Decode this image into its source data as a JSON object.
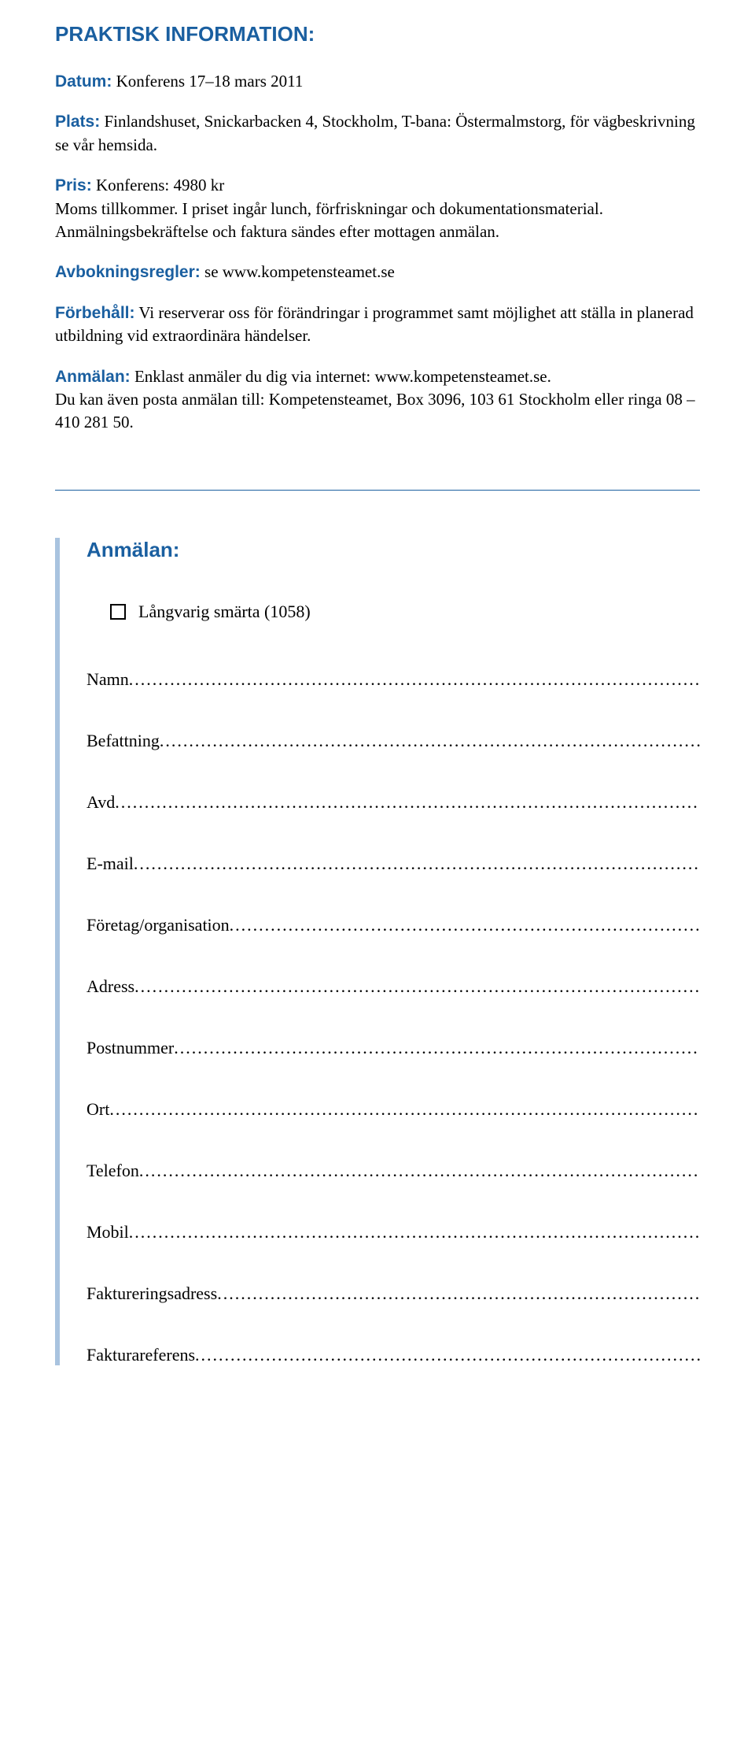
{
  "heading": "PRAKTISK INFORMATION:",
  "info": {
    "datum_label": "Datum:",
    "datum_text": " Konferens 17–18 mars 2011",
    "plats_label": "Plats:",
    "plats_text": " Finlandshuset, Snickarbacken 4, Stockholm, T-bana: Östermalmstorg, för vägbeskrivning se vår hemsida.",
    "pris_label": "Pris:",
    "pris_text1": " Konferens: 4980 kr",
    "pris_text2": "Moms tillkommer. I priset ingår lunch, förfriskningar och dokumentationsmaterial. Anmälningsbekräftelse och faktura sändes efter mottagen anmälan.",
    "avbokning_label": "Avbokningsregler:",
    "avbokning_text": " se www.kompetensteamet.se",
    "forbehall_label": "Förbehåll:",
    "forbehall_text": " Vi reserverar oss för förändringar i programmet samt möjlighet att ställa in planerad utbildning vid extraordinära händelser.",
    "anmalan_label": "Anmälan:",
    "anmalan_text1": " Enklast anmäler du dig via internet: www.kompetensteamet.se.",
    "anmalan_text2": "Du kan även posta anmälan till: Kompetensteamet, Box 3096, 103 61 Stockholm eller ringa 08 – 410 281 50."
  },
  "form": {
    "heading": "Anmälan:",
    "checkbox_option": "Långvarig smärta (1058)",
    "fields": {
      "namn": "Namn",
      "befattning": "Befattning",
      "avd": "Avd",
      "email": "E-mail",
      "foretag": "Företag/organisation",
      "adress": "Adress",
      "postnummer": "Postnummer",
      "ort": "Ort",
      "telefon": "Telefon",
      "mobil": "Mobil",
      "fakturaadress": "Faktureringsadress",
      "fakturareferens": "Fakturareferens"
    }
  }
}
